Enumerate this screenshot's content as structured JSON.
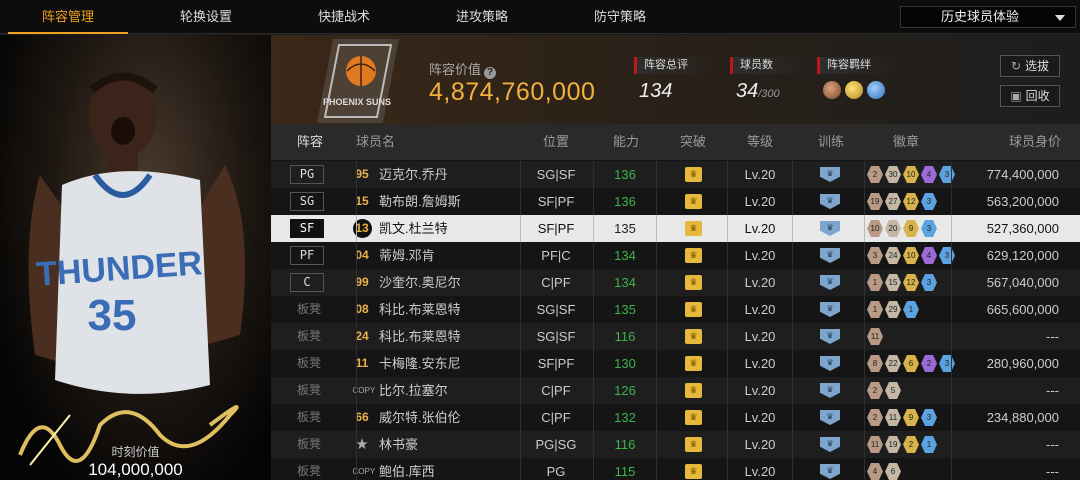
{
  "nav": {
    "tabs": [
      "阵容管理",
      "轮换设置",
      "快捷战术",
      "进攻策略",
      "防守策略"
    ],
    "active": 0,
    "dropdown": "历史球员体验"
  },
  "player_panel": {
    "jersey_text": "THUNDER",
    "jersey_number": "35",
    "value_label": "时刻价值",
    "value": "104,000,000"
  },
  "header": {
    "team_logo_text": "PHOENIX SUNS",
    "lineup_value_label": "阵容价值",
    "lineup_value": "4,874,760,000",
    "overall_label": "阵容总评",
    "overall": "134",
    "players_label": "球员数",
    "players_count": "34",
    "players_max": "/300",
    "chemistry_label": "阵容羁绊",
    "select_button": "选拔",
    "recycle_button": "回收"
  },
  "table": {
    "columns": [
      "阵容",
      "球员名",
      "位置",
      "能力",
      "突破",
      "等级",
      "训练",
      "徽章",
      "球员身价"
    ],
    "rows": [
      {
        "slot": "PG",
        "jersey": "95",
        "name": "迈克尔.乔丹",
        "position": "SG|SF",
        "rating": "136",
        "level": "Lv.20",
        "badges": [
          [
            "2",
            "#b89a86"
          ],
          [
            "30",
            "#c5b7a6"
          ],
          [
            "10",
            "#d8b24a"
          ],
          [
            "4",
            "#9a6ad6"
          ],
          [
            "3",
            "#5aa2e0"
          ]
        ],
        "value": "774,400,000"
      },
      {
        "slot": "SG",
        "jersey": "15",
        "name": "勒布朗.詹姆斯",
        "position": "SF|PF",
        "rating": "136",
        "level": "Lv.20",
        "badges": [
          [
            "19",
            "#b89a86"
          ],
          [
            "27",
            "#c5b7a6"
          ],
          [
            "12",
            "#d8b24a"
          ],
          [
            "3",
            "#5aa2e0"
          ]
        ],
        "value": "563,200,000"
      },
      {
        "slot": "SF",
        "jersey": "13",
        "name": "凯文.杜兰特",
        "position": "SF|PF",
        "rating": "135",
        "level": "Lv.20",
        "badges": [
          [
            "10",
            "#b89a86"
          ],
          [
            "20",
            "#c5b7a6"
          ],
          [
            "9",
            "#d8b24a"
          ],
          [
            "3",
            "#5aa2e0"
          ]
        ],
        "value": "527,360,000",
        "selected": true
      },
      {
        "slot": "PF",
        "jersey": "04",
        "name": "蒂姆.邓肯",
        "position": "PF|C",
        "rating": "134",
        "level": "Lv.20",
        "badges": [
          [
            "3",
            "#b89a86"
          ],
          [
            "24",
            "#c5b7a6"
          ],
          [
            "10",
            "#d8b24a"
          ],
          [
            "4",
            "#9a6ad6"
          ],
          [
            "3",
            "#5aa2e0"
          ]
        ],
        "value": "629,120,000"
      },
      {
        "slot": "C",
        "jersey": "99",
        "name": "沙奎尔.奥尼尔",
        "position": "C|PF",
        "rating": "134",
        "level": "Lv.20",
        "badges": [
          [
            "1",
            "#b89a86"
          ],
          [
            "15",
            "#c5b7a6"
          ],
          [
            "12",
            "#d8b24a"
          ],
          [
            "3",
            "#5aa2e0"
          ]
        ],
        "value": "567,040,000"
      },
      {
        "slot": "板凳",
        "jersey": "08",
        "name": "科比.布莱恩特",
        "position": "SG|SF",
        "rating": "135",
        "level": "Lv.20",
        "badges": [
          [
            "1",
            "#b89a86"
          ],
          [
            "29",
            "#c5b7a6"
          ],
          [
            "1",
            "#5aa2e0"
          ]
        ],
        "value": "665,600,000"
      },
      {
        "slot": "板凳",
        "jersey": "24",
        "name": "科比.布莱恩特",
        "position": "SG|SF",
        "rating": "116",
        "level": "Lv.20",
        "badges": [
          [
            "11",
            "#b89a86"
          ]
        ],
        "value": "---"
      },
      {
        "slot": "板凳",
        "jersey": "11",
        "name": "卡梅隆.安东尼",
        "position": "SF|PF",
        "rating": "130",
        "level": "Lv.20",
        "badges": [
          [
            "8",
            "#b89a86"
          ],
          [
            "22",
            "#c5b7a6"
          ],
          [
            "6",
            "#d8b24a"
          ],
          [
            "2",
            "#9a6ad6"
          ],
          [
            "3",
            "#5aa2e0"
          ]
        ],
        "value": "280,960,000"
      },
      {
        "slot": "板凳",
        "jersey": "COPY",
        "name": "比尔.拉塞尔",
        "position": "C|PF",
        "rating": "126",
        "level": "Lv.20",
        "badges": [
          [
            "2",
            "#b89a86"
          ],
          [
            "5",
            "#c5b7a6"
          ]
        ],
        "value": "---"
      },
      {
        "slot": "板凳",
        "jersey": "66",
        "name": "威尔特.张伯伦",
        "position": "C|PF",
        "rating": "132",
        "level": "Lv.20",
        "badges": [
          [
            "2",
            "#b89a86"
          ],
          [
            "11",
            "#c5b7a6"
          ],
          [
            "9",
            "#d8b24a"
          ],
          [
            "3",
            "#5aa2e0"
          ]
        ],
        "value": "234,880,000"
      },
      {
        "slot": "板凳",
        "jersey": "★",
        "name": "林书豪",
        "position": "PG|SG",
        "rating": "116",
        "level": "Lv.20",
        "badges": [
          [
            "11",
            "#b89a86"
          ],
          [
            "19",
            "#c5b7a6"
          ],
          [
            "2",
            "#d8b24a"
          ],
          [
            "1",
            "#5aa2e0"
          ]
        ],
        "value": "---"
      },
      {
        "slot": "板凳",
        "jersey": "COPY",
        "name": "鲍伯.库西",
        "position": "PG",
        "rating": "115",
        "level": "Lv.20",
        "badges": [
          [
            "4",
            "#b89a86"
          ],
          [
            "6",
            "#c5b7a6"
          ]
        ],
        "value": "---"
      }
    ]
  }
}
